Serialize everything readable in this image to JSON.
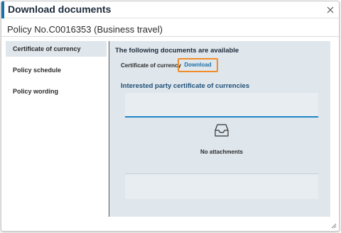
{
  "dialog": {
    "title": "Download documents",
    "close_icon": "close-icon"
  },
  "policy": {
    "title": "Policy No.C0016353 (Business travel)"
  },
  "sidebar": {
    "items": [
      {
        "label": "Certificate of currency",
        "active": true
      },
      {
        "label": "Policy schedule",
        "active": false
      },
      {
        "label": "Policy wording",
        "active": false
      }
    ]
  },
  "content": {
    "heading": "The following documents are available",
    "certificate_label": "Certificate of currency",
    "download_label": "Download",
    "section_heading": "Interested party certificate of currencies",
    "empty_icon": "inbox-icon",
    "empty_text": "No attachments"
  },
  "colors": {
    "accent": "#1d6fa8",
    "highlight": "#f28c28",
    "panel_bg": "#dfe6ec",
    "active_field_border": "#1d86c6"
  }
}
